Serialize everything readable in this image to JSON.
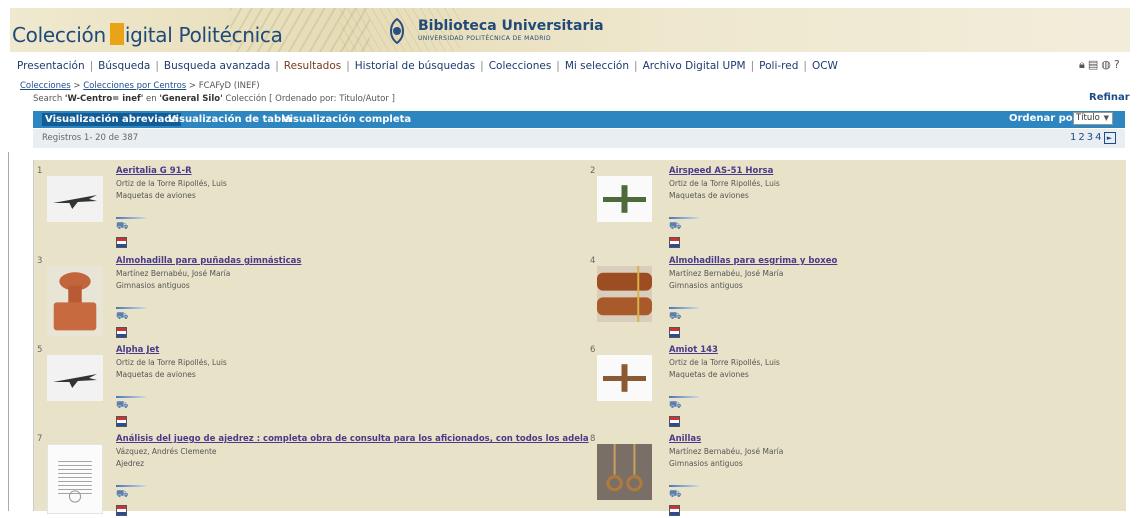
{
  "header": {
    "brand_left": "Colección",
    "brand_right": "igital Politécnica",
    "library_title": "Biblioteca Universitaria",
    "library_sub": "UNIVERSIDAD POLITÉCNICA DE MADRID"
  },
  "nav": [
    {
      "label": "Presentación",
      "active": false
    },
    {
      "label": "Búsqueda",
      "active": false
    },
    {
      "label": "Busqueda avanzada",
      "active": false
    },
    {
      "label": "Resultados",
      "active": true
    },
    {
      "label": "Historial de búsquedas",
      "active": false
    },
    {
      "label": "Colecciones",
      "active": false
    },
    {
      "label": "Mi selección",
      "active": false
    },
    {
      "label": "Archivo Digital UPM",
      "active": false
    },
    {
      "label": "Poli-red",
      "active": false
    },
    {
      "label": "OCW",
      "active": false
    }
  ],
  "top_icons": [
    "lock-icon",
    "document-icon",
    "globe-icon",
    "help-icon"
  ],
  "breadcrumb": {
    "items": [
      "Colecciones",
      "Colecciones por Centros",
      "FCAFyD (INEF)"
    ],
    "separator": ">"
  },
  "search": {
    "prefix": "Search",
    "query": "'W-Centro= inef'",
    "in_text": "en",
    "field": "'General Silo'",
    "collection_label": "Colección",
    "order_text": "[ Ordenado por: Titulo/Autor ]"
  },
  "refine_label": "Refinar",
  "tabs": {
    "abbreviated": "Visualización abreviada",
    "table": "Visualización de tabla",
    "full": "Visualización completa"
  },
  "order": {
    "label": "Ordenar por:",
    "value": "Título"
  },
  "records_text": "Registros 1- 20 de 387",
  "pages": [
    "1",
    "2",
    "3",
    "4"
  ],
  "records": [
    {
      "num": "1",
      "title": "Aeritalia G 91-R",
      "author": "Ortiz de la Torre Ripollés, Luis",
      "collection": "Maquetas de aviones",
      "thumb": "jet"
    },
    {
      "num": "2",
      "title": "Airspeed AS-51 Horsa",
      "author": "Ortiz de la Torre Ripollés, Luis",
      "collection": "Maquetas de aviones",
      "thumb": "glider"
    },
    {
      "num": "3",
      "title": "Almohadilla para puñadas gimnásticas",
      "author": "Martínez Bernabéu, José María",
      "collection": "Gimnasios antiguos",
      "thumb": "pad"
    },
    {
      "num": "4",
      "title": "Almohadillas para esgrima y boxeo",
      "author": "Martínez Bernabéu, José María",
      "collection": "Gimnasios antiguos",
      "thumb": "pads"
    },
    {
      "num": "5",
      "title": "Alpha Jet",
      "author": "Ortiz de la Torre Ripollés, Luis",
      "collection": "Maquetas de aviones",
      "thumb": "jet"
    },
    {
      "num": "6",
      "title": "Amiot 143",
      "author": "Ortiz de la Torre Ripollés, Luis",
      "collection": "Maquetas de aviones",
      "thumb": "plane"
    },
    {
      "num": "7",
      "title": "Análisis del juego de ajedrez : completa obra de consulta para los aficionados, con todos los adela",
      "author": "Vázquez, Andrés Clemente",
      "collection": "Ajedrez",
      "thumb": "book"
    },
    {
      "num": "8",
      "title": "Anillas",
      "author": "Martínez Bernabéu, José María",
      "collection": "Gimnasios antiguos",
      "thumb": "rings"
    }
  ]
}
